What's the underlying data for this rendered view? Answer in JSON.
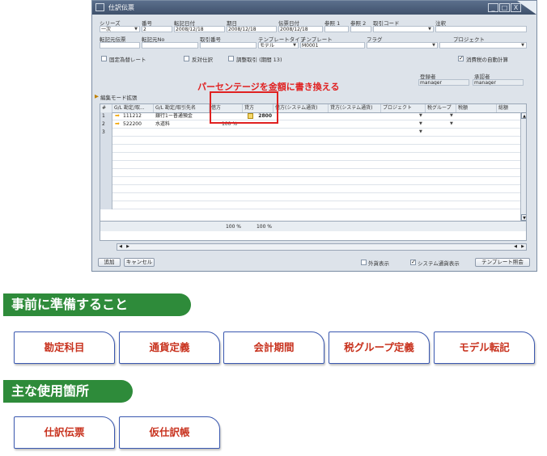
{
  "window": {
    "title": "仕訳伝票",
    "controls": [
      "_",
      "□",
      "X"
    ]
  },
  "header": {
    "series_label": "シリーズ",
    "series_value": "一次",
    "number_label": "番号",
    "number_value": "2",
    "posting_date_label": "転記日付",
    "posting_date_value": "2008/12/18",
    "due_date_label": "期日",
    "due_date_value": "2008/12/18",
    "doc_date_label": "伝票日付",
    "doc_date_value": "2008/12/18",
    "ref1_label": "参照 1",
    "ref2_label": "参照 2",
    "txcode_label": "取引コード",
    "remarks_label": "注釈",
    "origin_label": "転記元伝票",
    "origin_no_label": "転記元No",
    "trans_no_label": "取引番号",
    "template_type_label": "テンプレートタイプ",
    "template_type_value": "モデル",
    "template_label": "テンプレート",
    "template_value": "M0001",
    "indicator_label": "フラグ",
    "project_label": "プロジェクト",
    "fixed_rate_label": "固定為替レート",
    "reverse_label": "反対仕訳",
    "adjust_label": "調整取引 (期間 13)",
    "auto_vat_label": "消費税の自動計算",
    "creator_label": "登録者",
    "creator_value": "manager",
    "approver_label": "承認者",
    "approver_value": "manager",
    "edit_mode_label": "編集モード拡張"
  },
  "annotation": "パーセンテージを金額に書き換える",
  "grid": {
    "columns": [
      "#",
      "G/L 勘定/取...",
      "G/L 勘定/取引先名",
      "借方",
      "貸方",
      "借方(システム通貨)",
      "貸方(システム通貨)",
      "プロジェクト",
      "税グループ",
      "税額",
      "総額"
    ],
    "rows": [
      {
        "num": "1",
        "account": "111212",
        "name": "銀行1ー普通預金",
        "debit": "",
        "credit": "2800"
      },
      {
        "num": "2",
        "account": "522200",
        "name": "水道料",
        "debit": "100 %",
        "credit": ""
      },
      {
        "num": "3",
        "account": "",
        "name": "",
        "debit": "",
        "credit": ""
      }
    ],
    "total_debit": "100 %",
    "total_credit": "100 %"
  },
  "footer": {
    "add_button": "追加",
    "cancel_button": "キャンセル",
    "fc_display": "外貨表示",
    "sys_currency_display": "システム通貨表示",
    "template_button": "テンプレート照会"
  },
  "sections": {
    "prep_title": "事前に準備すること",
    "prep_items": [
      "勘定科目",
      "通貨定義",
      "会計期間",
      "税グループ定義",
      "モデル転記"
    ],
    "usage_title": "主な使用箇所",
    "usage_items": [
      "仕訳伝票",
      "仮仕訳帳"
    ]
  },
  "colors": {
    "banner_green": "#2e8b3a",
    "button_text_red": "#c8321e",
    "button_border_blue": "#3a58b0",
    "highlight_red": "#e02020"
  }
}
